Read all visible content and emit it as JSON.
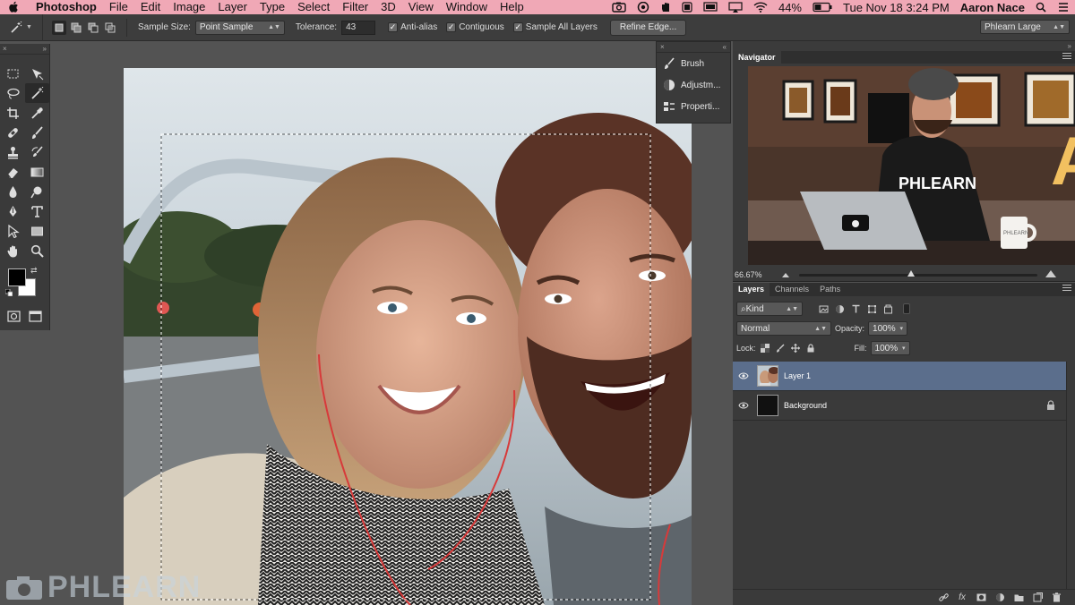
{
  "menubar": {
    "app_name": "Photoshop",
    "items": [
      "File",
      "Edit",
      "Image",
      "Layer",
      "Type",
      "Select",
      "Filter",
      "3D",
      "View",
      "Window",
      "Help"
    ],
    "battery": "44%",
    "clock": "Tue Nov 18  3:24 PM",
    "user": "Aaron Nace",
    "bg_color": "#f0a8b6"
  },
  "options_bar": {
    "sample_size_label": "Sample Size:",
    "sample_size_value": "Point Sample",
    "tolerance_label": "Tolerance:",
    "tolerance_value": "43",
    "anti_alias": "Anti-alias",
    "contiguous": "Contiguous",
    "sample_all_layers": "Sample All Layers",
    "refine_edge": "Refine Edge...",
    "workspace": "Phlearn Large"
  },
  "toolbox": {
    "tools": [
      "marquee-tool",
      "move-tool",
      "lasso-tool",
      "magic-wand-tool",
      "crop-tool",
      "eyedropper-tool",
      "healing-brush-tool",
      "brush-tool",
      "clone-stamp-tool",
      "history-brush-tool",
      "eraser-tool",
      "gradient-tool",
      "blur-tool",
      "dodge-tool",
      "pen-tool",
      "type-tool",
      "path-selection-tool",
      "rectangle-tool",
      "hand-tool",
      "zoom-tool"
    ],
    "active_tool": "magic-wand-tool",
    "foreground_color": "#000000",
    "background_color": "#ffffff"
  },
  "canvas": {
    "watermark": "PHLEARN"
  },
  "dock": {
    "items": [
      {
        "label": "Brush",
        "icon": "brush-icon"
      },
      {
        "label": "Adjustm...",
        "icon": "adjustments-icon"
      },
      {
        "label": "Properti...",
        "icon": "properties-icon"
      }
    ]
  },
  "navigator": {
    "tab": "Navigator",
    "zoom": "66.67%",
    "thumb_shirt_text": "PHLEARN",
    "thumb_mug_text": "PHLEARN",
    "thumb_sign_letter": "A"
  },
  "layers_panel": {
    "tabs": [
      "Layers",
      "Channels",
      "Paths"
    ],
    "active_tab": "Layers",
    "filter_kind": "Kind",
    "blend_mode": "Normal",
    "opacity_label": "Opacity:",
    "opacity_value": "100%",
    "lock_label": "Lock:",
    "fill_label": "Fill:",
    "fill_value": "100%",
    "layers": [
      {
        "name": "Layer 1",
        "selected": true,
        "locked": false
      },
      {
        "name": "Background",
        "selected": false,
        "locked": true
      }
    ],
    "footer_fx": "fx"
  },
  "colors": {
    "selection_highlight": "#5b6e8c",
    "panel_bg": "#3a3a3a",
    "workspace_bg": "#535353"
  }
}
